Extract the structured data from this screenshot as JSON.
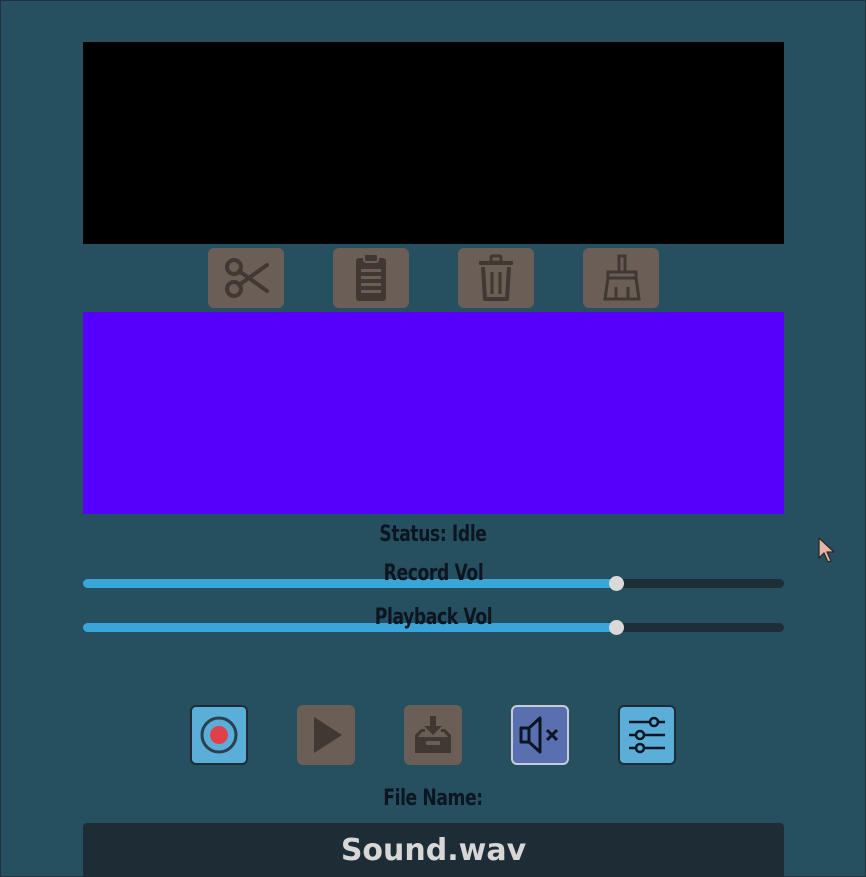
{
  "edit_toolbar": {
    "cut": "scissors-icon",
    "paste": "clipboard-icon",
    "delete": "trash-icon",
    "clear": "broom-icon"
  },
  "status": {
    "text": "Status: Idle"
  },
  "sliders": {
    "record": {
      "label": "Record Vol",
      "value": 0.76
    },
    "playback": {
      "label": "Playback Vol",
      "value": 0.76
    }
  },
  "transport": {
    "record": "record-icon",
    "play": "play-icon",
    "save": "save-tray-icon",
    "mute": "speaker-mute-icon",
    "settings": "sliders-settings-icon"
  },
  "file": {
    "label": "File Name:",
    "value": "Sound.wav"
  },
  "colors": {
    "background": "#26505f",
    "waveform_top": "#000000",
    "waveform_bottom": "#5600fb",
    "slider_fill": "#3aa5d8",
    "button_disabled": "#6b5e57",
    "button_active": "#5aaed8",
    "mute_active": "#5a6fb0",
    "record_dot": "#e0404a"
  }
}
